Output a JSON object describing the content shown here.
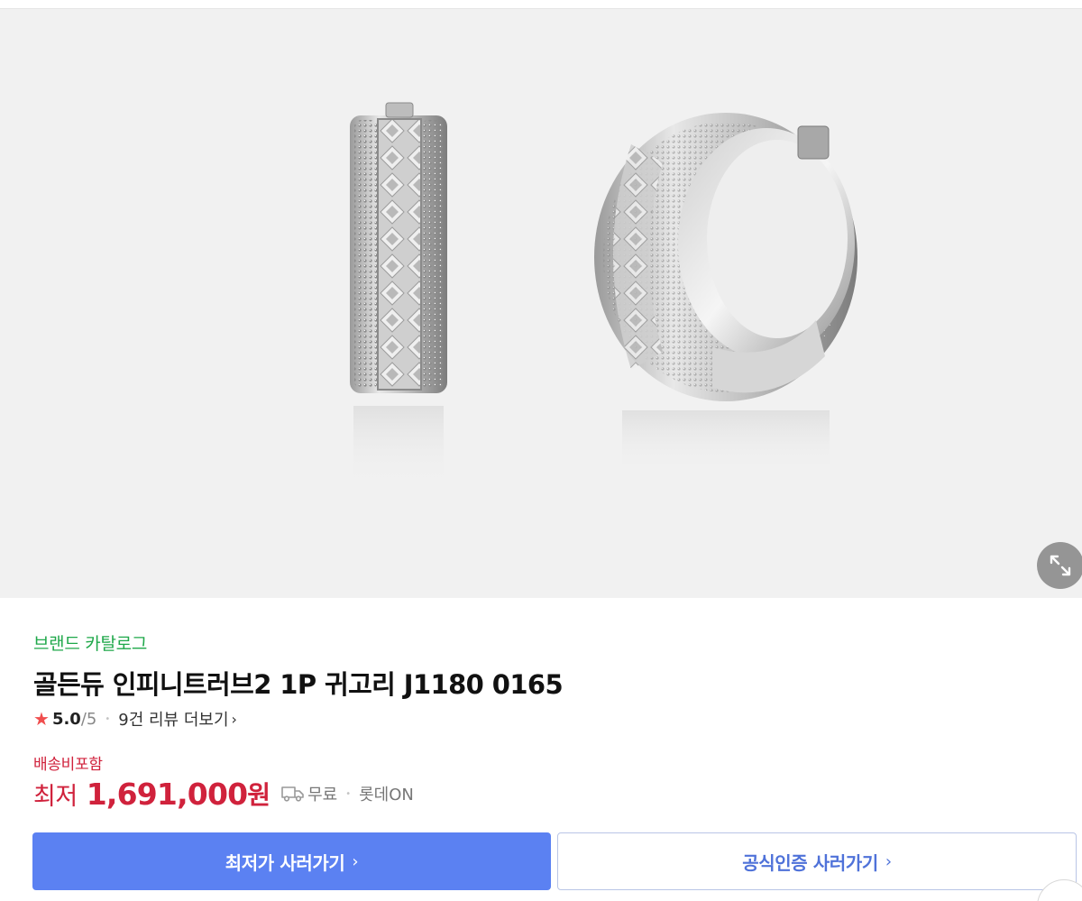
{
  "gallery": {
    "image_alt": "earring-product-image",
    "expand_icon": "expand-diagonal-icon"
  },
  "brand": {
    "label": "브랜드 카탈로그"
  },
  "product": {
    "title": "골든듀 인피니트러브2 1P 귀고리 J1180 0165"
  },
  "rating": {
    "star_icon": "★",
    "score": "5.0",
    "max": "/5",
    "separator": "•",
    "reviews": "9건 리뷰 더보기",
    "chevron": "›"
  },
  "shipping": {
    "note": "배송비포함"
  },
  "price": {
    "label": "최저",
    "value": "1,691,000",
    "unit": "원",
    "ship_free": "무료",
    "separator": "•",
    "seller": "롯데ON"
  },
  "buttons": {
    "lowest": "최저가 사러가기",
    "official": "공식인증 사러가기",
    "chevron": "›"
  },
  "colors": {
    "brand_green": "#1fa84a",
    "price_red": "#d0223c",
    "primary_blue": "#5b81f2",
    "outline_blue": "#4f72d9"
  }
}
